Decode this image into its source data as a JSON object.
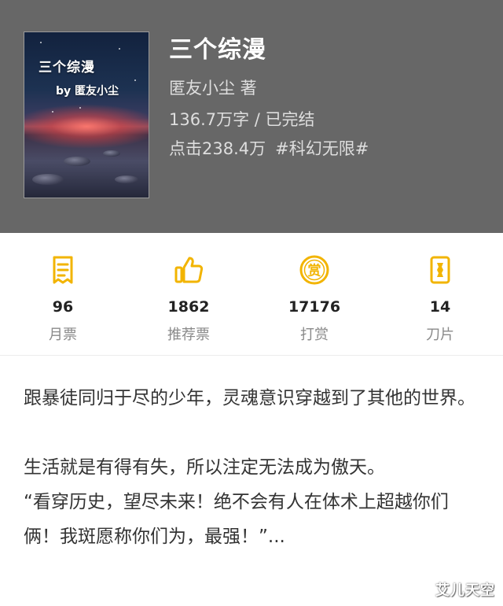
{
  "book": {
    "title": "三个综漫",
    "author_line": "匿友小尘  著",
    "words_status": "136.7万字 / 已完结",
    "clicks": "点击238.4万",
    "tag": "#科幻无限#",
    "cover": {
      "title": "三个综漫",
      "author": "by 匿友小尘"
    }
  },
  "stats": [
    {
      "count": "96",
      "label": "月票",
      "icon": "ticket-icon"
    },
    {
      "count": "1862",
      "label": "推荐票",
      "icon": "thumbs-up-icon"
    },
    {
      "count": "17176",
      "label": "打赏",
      "icon": "reward-coin-icon"
    },
    {
      "count": "14",
      "label": "刀片",
      "icon": "blade-icon"
    }
  ],
  "description": [
    "跟暴徒同归于尽的少年，灵魂意识穿越到了其他的世界。",
    "生活就是有得有失，所以注定无法成为傲天。",
    "“看穿历史，望尽未来！绝不会有人在体术上超越你们俩！我斑愿称你们为，最强！”..."
  ],
  "watermark": "艾儿天空",
  "colors": {
    "accent": "#f2b400",
    "header_bg": "#676767",
    "text": "#333333"
  }
}
